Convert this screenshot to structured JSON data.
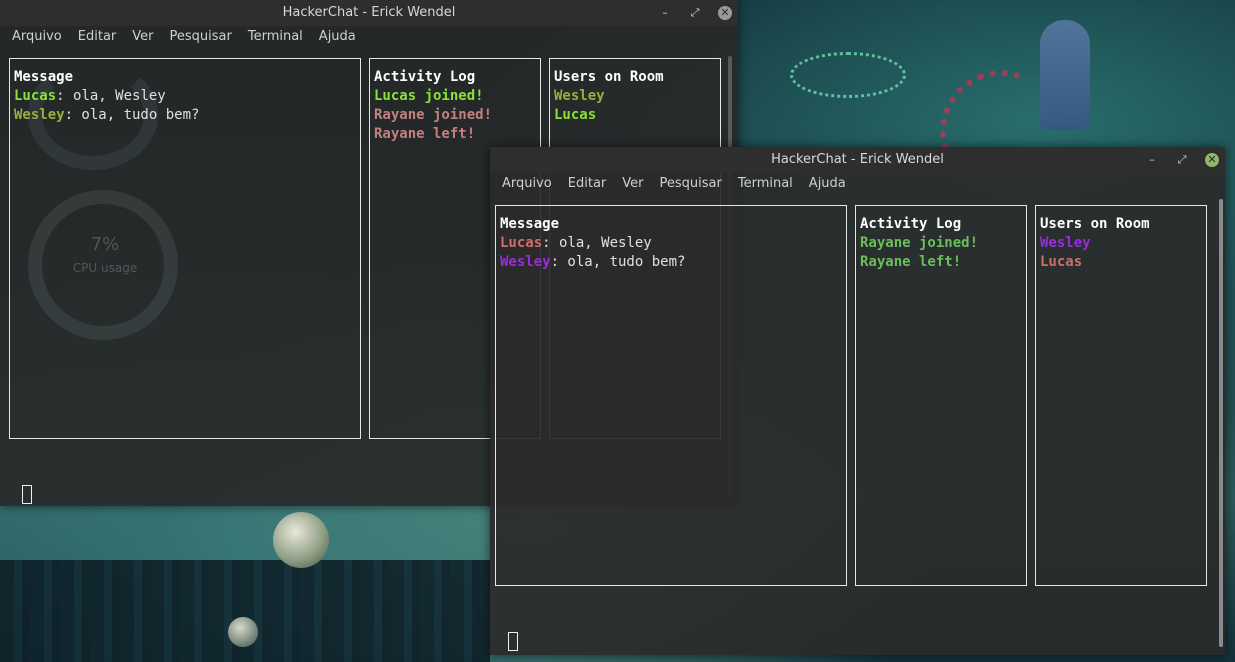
{
  "colors": {
    "lime": "#8ae234",
    "olive": "#97b03a",
    "dustyred": "#c47f7f",
    "rose": "#d06d6d",
    "purple": "#9b2be0",
    "green": "#6bbf59"
  },
  "wallpaper": {
    "hud_percent": "7%",
    "hud_label": "CPU usage"
  },
  "window1": {
    "title": "HackerChat - Erick Wendel",
    "menu": [
      "Arquivo",
      "Editar",
      "Ver",
      "Pesquisar",
      "Terminal",
      "Ajuda"
    ],
    "message": {
      "header": "Message",
      "lines": [
        {
          "user": "Lucas",
          "text": ": ola, Wesley"
        },
        {
          "user": "Wesley",
          "text": ": ola, tudo bem?"
        }
      ]
    },
    "activity": {
      "header": "Activity Log",
      "lines": [
        "Lucas joined!",
        "Rayane joined!",
        "Rayane left!"
      ]
    },
    "users": {
      "header": "Users on Room",
      "lines": [
        "Wesley",
        "Lucas"
      ]
    }
  },
  "window2": {
    "title": "HackerChat - Erick Wendel",
    "menu": [
      "Arquivo",
      "Editar",
      "Ver",
      "Pesquisar",
      "Terminal",
      "Ajuda"
    ],
    "message": {
      "header": "Message",
      "lines": [
        {
          "user": "Lucas",
          "text": ": ola, Wesley"
        },
        {
          "user": "Wesley",
          "text": ": ola, tudo bem?"
        }
      ]
    },
    "activity": {
      "header": "Activity Log",
      "lines": [
        "Rayane joined!",
        "Rayane left!"
      ]
    },
    "users": {
      "header": "Users on Room",
      "lines": [
        "Wesley",
        "Lucas"
      ]
    }
  }
}
